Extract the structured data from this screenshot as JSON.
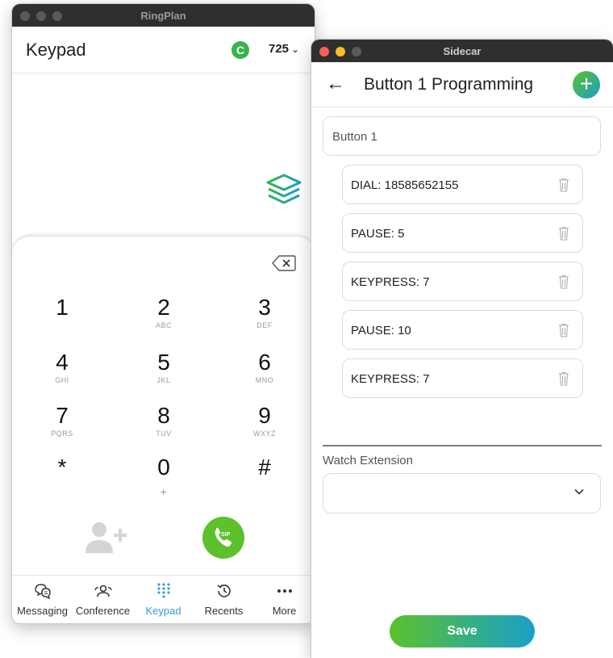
{
  "ringplan": {
    "window_title": "RingPlan",
    "header": {
      "title": "Keypad",
      "extension": "725",
      "refresh_icon": "C"
    },
    "keys": [
      {
        "num": "1",
        "letters": ""
      },
      {
        "num": "2",
        "letters": "ABC"
      },
      {
        "num": "3",
        "letters": "DEF"
      },
      {
        "num": "4",
        "letters": "GHI"
      },
      {
        "num": "5",
        "letters": "JKL"
      },
      {
        "num": "6",
        "letters": "MNO"
      },
      {
        "num": "7",
        "letters": "PQRS"
      },
      {
        "num": "8",
        "letters": "TUV"
      },
      {
        "num": "9",
        "letters": "WXYZ"
      },
      {
        "num": "*",
        "letters": ""
      },
      {
        "num": "0",
        "letters": "+"
      },
      {
        "num": "#",
        "letters": ""
      }
    ],
    "call_label": "SIP",
    "tabs": [
      {
        "label": "Messaging",
        "icon": "messaging-icon"
      },
      {
        "label": "Conference",
        "icon": "conference-icon"
      },
      {
        "label": "Keypad",
        "icon": "keypad-icon",
        "active": true
      },
      {
        "label": "Recents",
        "icon": "recents-icon"
      },
      {
        "label": "More",
        "icon": "more-icon"
      }
    ],
    "colors": {
      "green": "#37b44a",
      "call_green": "#5cc12c",
      "active_tab": "#3a9ad9"
    }
  },
  "sidecar": {
    "window_title": "Sidecar",
    "header": {
      "title": "Button 1 Programming",
      "back": "←",
      "add": "+"
    },
    "button_name": "Button 1",
    "steps": [
      {
        "label": "DIAL: 18585652155"
      },
      {
        "label": "PAUSE: 5"
      },
      {
        "label": "KEYPRESS: 7"
      },
      {
        "label": "PAUSE: 10"
      },
      {
        "label": "KEYPRESS: 7"
      }
    ],
    "watch_extension_label": "Watch Extension",
    "watch_extension_value": "",
    "save_label": "Save",
    "colors": {
      "gradient_start": "#5cc12c",
      "gradient_end": "#1aa0c8"
    }
  }
}
